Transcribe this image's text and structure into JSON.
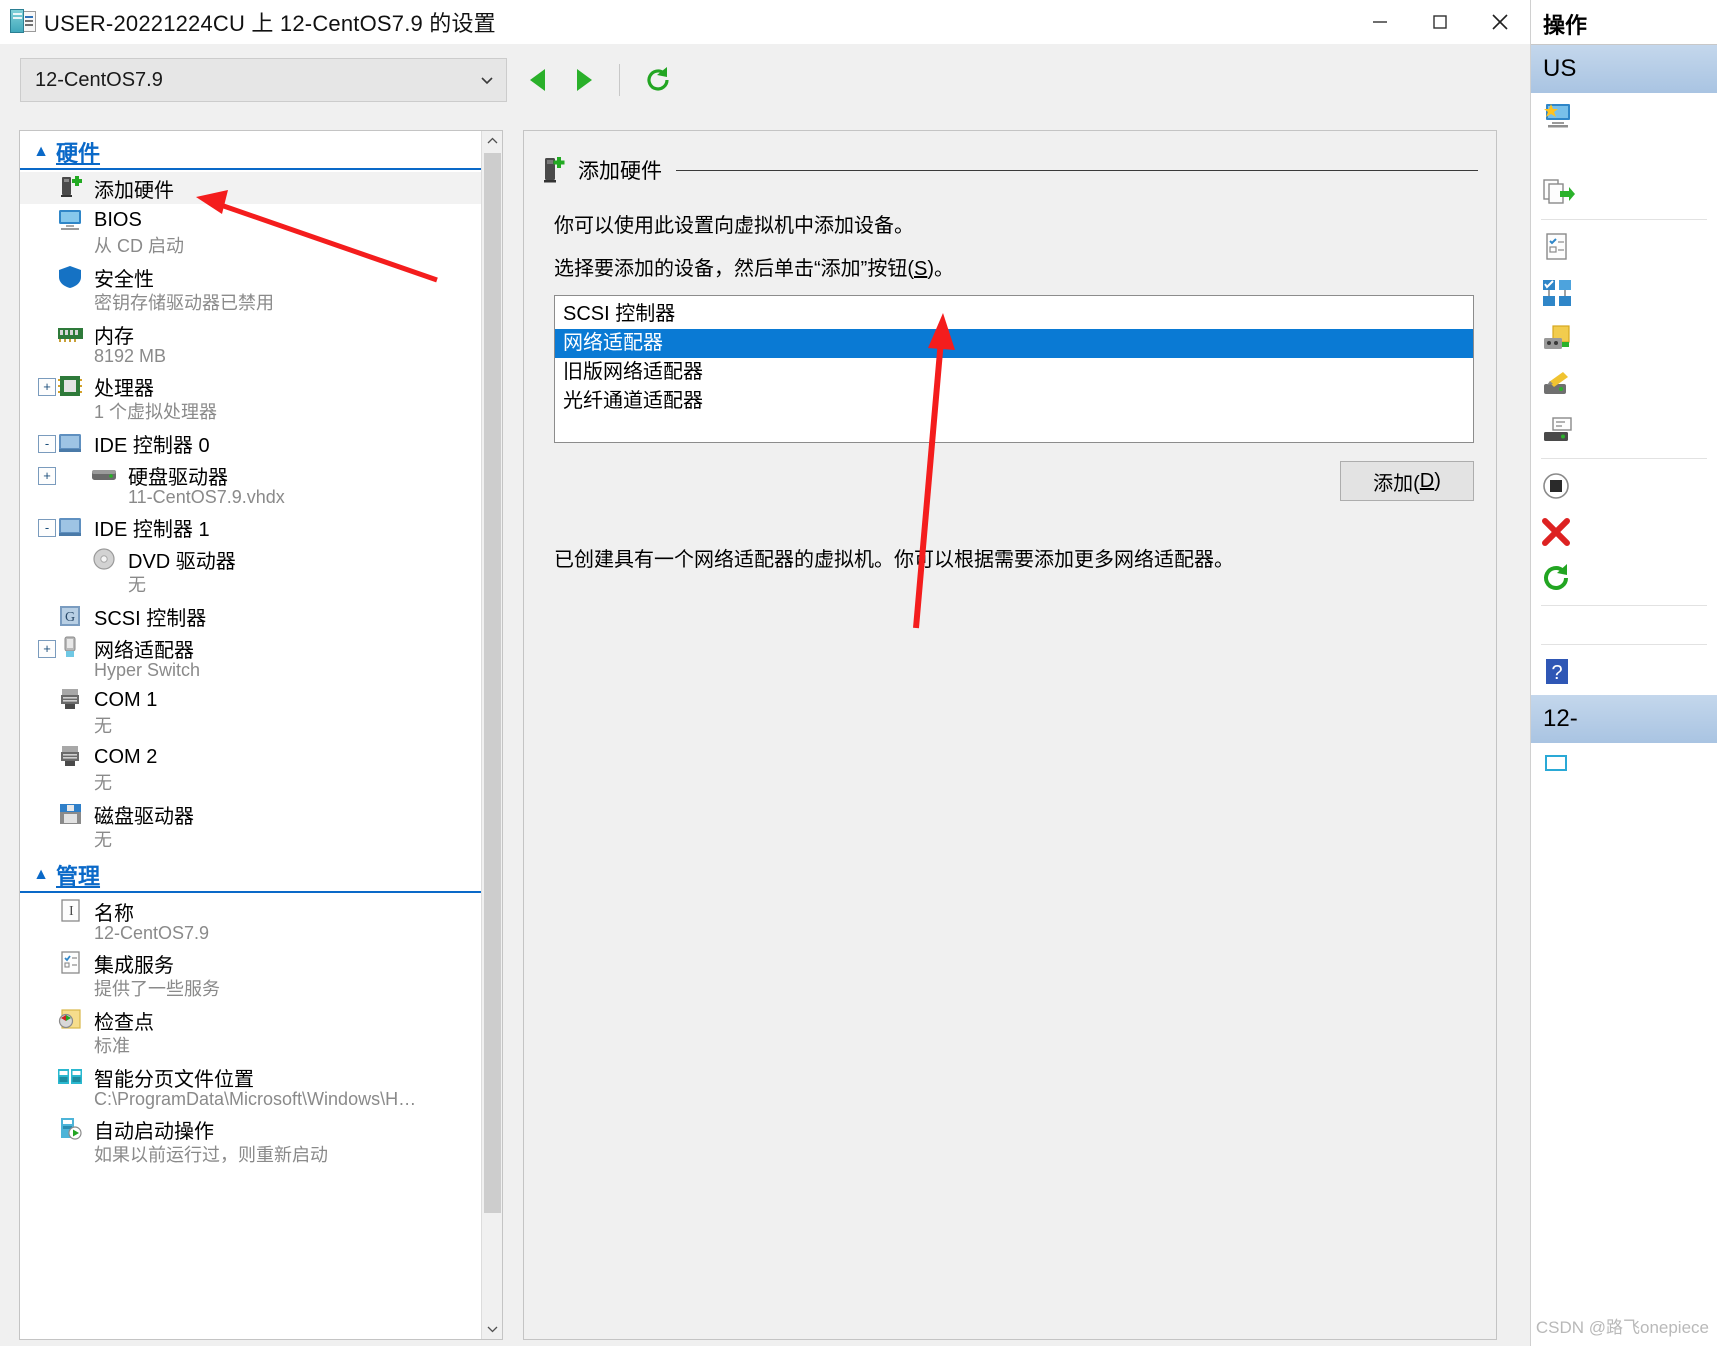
{
  "window": {
    "title": "USER-20221224CU 上 12-CentOS7.9 的设置",
    "title_icon": "vm-settings-icon",
    "minimize": "minimize-icon",
    "maximize": "maximize-icon",
    "close": "close-icon"
  },
  "toolbar": {
    "vm_selected": "12-CentOS7.9",
    "dropdown_icon": "chevron-down-icon",
    "back_icon": "nav-back-icon",
    "forward_icon": "nav-forward-icon",
    "refresh_icon": "refresh-icon"
  },
  "tree": {
    "hardware": {
      "header": "硬件",
      "collapse_icon": "chevron-up-icon",
      "items": [
        {
          "label": "添加硬件",
          "sub": "",
          "icon": "add-hardware-icon",
          "expander": "",
          "selected": true,
          "indent": 1
        },
        {
          "label": "BIOS",
          "sub": "从 CD 启动",
          "icon": "bios-monitor-icon",
          "expander": "",
          "selected": false,
          "indent": 1
        },
        {
          "label": "安全性",
          "sub": "密钥存储驱动器已禁用",
          "icon": "security-shield-icon",
          "expander": "",
          "selected": false,
          "indent": 1
        },
        {
          "label": "内存",
          "sub": "8192 MB",
          "icon": "memory-icon",
          "expander": "",
          "selected": false,
          "indent": 1
        },
        {
          "label": "处理器",
          "sub": "1 个虚拟处理器",
          "icon": "processor-icon",
          "expander": "+",
          "selected": false,
          "indent": 1
        },
        {
          "label": "IDE 控制器 0",
          "sub": "",
          "icon": "ide-controller-icon",
          "expander": "-",
          "selected": false,
          "indent": 1
        },
        {
          "label": "硬盘驱动器",
          "sub": "11-CentOS7.9.vhdx",
          "icon": "hard-drive-icon",
          "expander": "+",
          "selected": false,
          "indent": 2
        },
        {
          "label": "IDE 控制器 1",
          "sub": "",
          "icon": "ide-controller-icon",
          "expander": "-",
          "selected": false,
          "indent": 1
        },
        {
          "label": "DVD 驱动器",
          "sub": "无",
          "icon": "dvd-drive-icon",
          "expander": "",
          "selected": false,
          "indent": 2
        },
        {
          "label": "SCSI 控制器",
          "sub": "",
          "icon": "scsi-controller-icon",
          "expander": "",
          "selected": false,
          "indent": 1
        },
        {
          "label": "网络适配器",
          "sub": "Hyper Switch",
          "icon": "network-adapter-icon",
          "expander": "+",
          "selected": false,
          "indent": 1
        },
        {
          "label": "COM 1",
          "sub": "无",
          "icon": "com-port-icon",
          "expander": "",
          "selected": false,
          "indent": 1
        },
        {
          "label": "COM 2",
          "sub": "无",
          "icon": "com-port-icon",
          "expander": "",
          "selected": false,
          "indent": 1
        },
        {
          "label": "磁盘驱动器",
          "sub": "无",
          "icon": "floppy-drive-icon",
          "expander": "",
          "selected": false,
          "indent": 1
        }
      ]
    },
    "management": {
      "header": "管理",
      "collapse_icon": "chevron-up-icon",
      "items": [
        {
          "label": "名称",
          "sub": "12-CentOS7.9",
          "icon": "name-text-icon",
          "expander": "",
          "selected": false,
          "indent": 1
        },
        {
          "label": "集成服务",
          "sub": "提供了一些服务",
          "icon": "integration-services-icon",
          "expander": "",
          "selected": false,
          "indent": 1
        },
        {
          "label": "检查点",
          "sub": "标准",
          "icon": "checkpoint-icon",
          "expander": "",
          "selected": false,
          "indent": 1
        },
        {
          "label": "智能分页文件位置",
          "sub": "C:\\ProgramData\\Microsoft\\Windows\\H…",
          "icon": "smart-paging-icon",
          "expander": "",
          "selected": false,
          "indent": 1
        },
        {
          "label": "自动启动操作",
          "sub": "如果以前运行过，则重新启动",
          "icon": "automatic-start-icon",
          "expander": "",
          "selected": false,
          "indent": 1
        }
      ]
    },
    "scrollbar": {
      "up_icon": "scroll-up-icon",
      "down_icon": "scroll-down-icon"
    }
  },
  "content": {
    "header_title": "添加硬件",
    "header_icon": "add-hardware-icon",
    "paragraph1": "你可以使用此设置向虚拟机中添加设备。",
    "paragraph2_pre": "选择要添加的设备，然后单击“添加”按钮(",
    "paragraph2_key": "S",
    "paragraph2_post": ")。",
    "device_list": [
      {
        "label": "SCSI 控制器",
        "selected": false
      },
      {
        "label": "网络适配器",
        "selected": true
      },
      {
        "label": "旧版网络适配器",
        "selected": false
      },
      {
        "label": "光纤通道适配器",
        "selected": false
      }
    ],
    "add_button_pre": "添加(",
    "add_button_key": "D",
    "add_button_post": ")",
    "note": "已创建具有一个网络适配器的虚拟机。你可以根据需要添加更多网络适配器。"
  },
  "actions": {
    "title": "操作",
    "host_header": "US",
    "vm_header": "12-",
    "items": [
      {
        "icon": "new-vm-icon"
      },
      {
        "icon": "import-vm-icon"
      },
      {
        "icon": "hyper-v-settings-icon"
      },
      {
        "icon": "virtual-switch-manager-icon"
      },
      {
        "icon": "virtual-san-manager-icon"
      },
      {
        "icon": "edit-disk-icon"
      },
      {
        "icon": "inspect-disk-icon"
      },
      {
        "icon": "stop-service-icon"
      },
      {
        "icon": "remove-server-icon"
      },
      {
        "icon": "refresh-icon"
      },
      {
        "icon": "help-icon"
      }
    ]
  },
  "watermark": "CSDN @路飞onepiece"
}
